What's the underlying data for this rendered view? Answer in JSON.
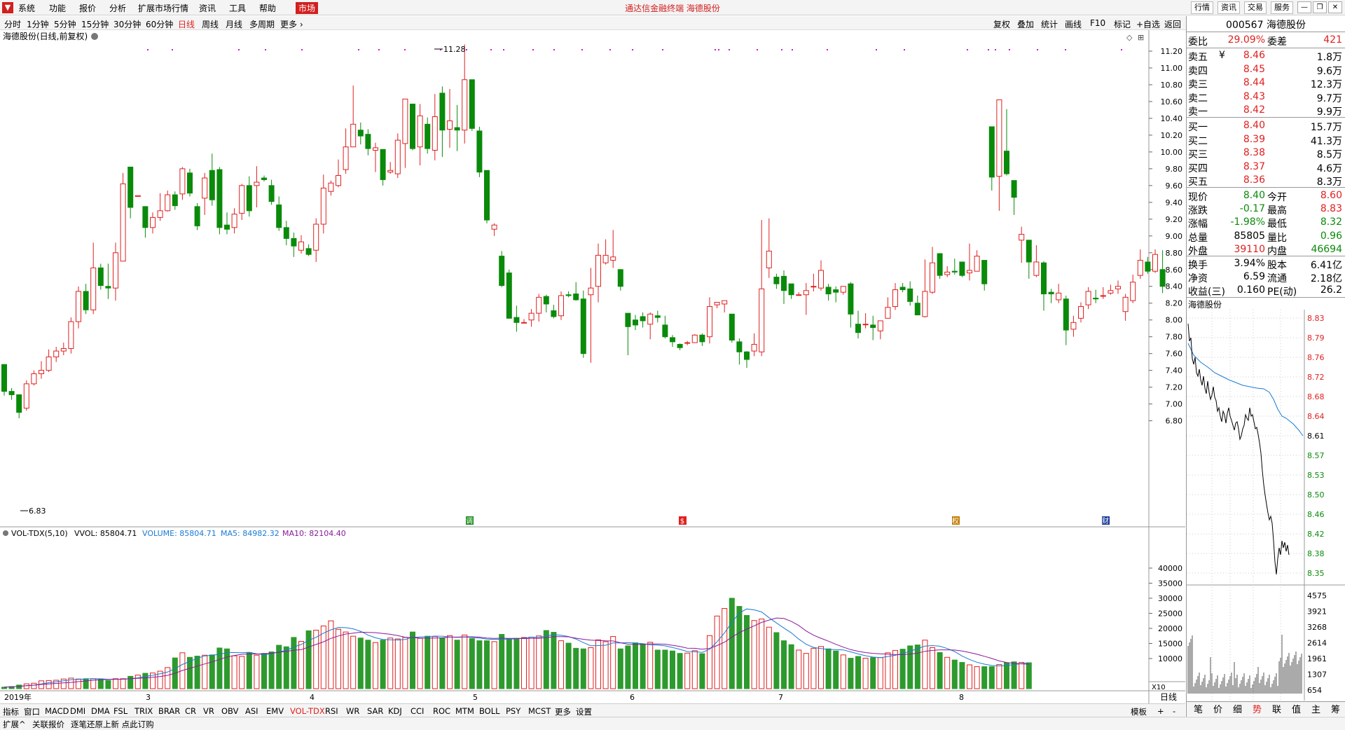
{
  "menubar": {
    "items": [
      "系统",
      "功能",
      "报价",
      "分析",
      "扩展市场行情",
      "资讯",
      "工具",
      "帮助"
    ],
    "active": "市场",
    "title": "通达信金融终端  海德股份",
    "right_buttons": [
      "行情",
      "资讯",
      "交易",
      "服务"
    ]
  },
  "periods": {
    "items": [
      "分时",
      "1分钟",
      "5分钟",
      "15分钟",
      "30分钟",
      "60分钟",
      "日线",
      "周线",
      "月线",
      "多周期",
      "更多"
    ],
    "active": "日线",
    "right": [
      "复权",
      "叠加",
      "统计",
      "画线",
      "F10",
      "标记",
      "+自选",
      "返回"
    ]
  },
  "main_chart": {
    "label": "海德股份(日线,前复权)",
    "high_mark": "11.28",
    "low_mark": "6.83",
    "markers": [
      "调",
      "$",
      "权",
      "财"
    ]
  },
  "vol_header": {
    "name": "VOL-TDX(5,10)",
    "vvol": "VVOL: 85804.71",
    "volume": "VOLUME: 85804.71",
    "ma5": "MA5: 84982.32",
    "ma10": "MA10: 82104.40"
  },
  "x_axis": {
    "year": "2019年",
    "months": [
      "3",
      "4",
      "5",
      "6",
      "7",
      "8"
    ],
    "unit": "X10",
    "period": "日线"
  },
  "indicator_tabs": [
    "指标",
    "窗口",
    "MACD",
    "DMI",
    "DMA",
    "FSL",
    "TRIX",
    "BRAR",
    "CR",
    "VR",
    "OBV",
    "ASI",
    "EMV",
    "VOL-TDX",
    "RSI",
    "WR",
    "SAR",
    "KDJ",
    "CCI",
    "ROC",
    "MTM",
    "BOLL",
    "PSY",
    "MCST",
    "更多",
    "设置"
  ],
  "indicator_active": "VOL-TDX",
  "template_label": "模板",
  "status": {
    "items": [
      "扩展^",
      "关联报价",
      "逐笔还原上新 点此订购"
    ]
  },
  "quote": {
    "code": "000567",
    "name": "海德股份",
    "weibi_label": "委比",
    "weibi": "29.09%",
    "weicha_label": "委差",
    "weicha": "421",
    "asks": [
      {
        "label": "卖五",
        "price": "8.46",
        "vol": "1.8万"
      },
      {
        "label": "卖四",
        "price": "8.45",
        "vol": "9.6万"
      },
      {
        "label": "卖三",
        "price": "8.44",
        "vol": "12.3万"
      },
      {
        "label": "卖二",
        "price": "8.43",
        "vol": "9.7万"
      },
      {
        "label": "卖一",
        "price": "8.42",
        "vol": "9.9万"
      }
    ],
    "bids": [
      {
        "label": "买一",
        "price": "8.40",
        "vol": "15.7万"
      },
      {
        "label": "买二",
        "price": "8.39",
        "vol": "41.3万"
      },
      {
        "label": "买三",
        "price": "8.38",
        "vol": "8.5万"
      },
      {
        "label": "买四",
        "price": "8.37",
        "vol": "4.6万"
      },
      {
        "label": "买五",
        "price": "8.36",
        "vol": "8.3万"
      }
    ],
    "yen": "¥",
    "stats": [
      {
        "l1": "现价",
        "v1": "8.40",
        "c1": "grn",
        "l2": "今开",
        "v2": "8.60",
        "c2": "red"
      },
      {
        "l1": "涨跌",
        "v1": "-0.17",
        "c1": "grn",
        "l2": "最高",
        "v2": "8.83",
        "c2": "red"
      },
      {
        "l1": "涨幅",
        "v1": "-1.98%",
        "c1": "grn",
        "l2": "最低",
        "v2": "8.32",
        "c2": "grn"
      },
      {
        "l1": "总量",
        "v1": "85805",
        "c1": "",
        "l2": "量比",
        "v2": "0.96",
        "c2": "grn"
      },
      {
        "l1": "外盘",
        "v1": "39110",
        "c1": "red",
        "l2": "内盘",
        "v2": "46694",
        "c2": "grn"
      }
    ],
    "stats2": [
      {
        "l1": "换手",
        "v1": "3.94%",
        "l2": "股本",
        "v2": "6.41亿"
      },
      {
        "l1": "净资",
        "v1": "6.59",
        "l2": "流通",
        "v2": "2.18亿"
      },
      {
        "l1": "收益(三)",
        "v1": "0.160",
        "l2": "PE(动)",
        "v2": "26.2"
      }
    ],
    "mini_title": "海德股份",
    "mini_price_axis": [
      "8.83",
      "8.79",
      "8.76",
      "8.72",
      "8.68",
      "8.64",
      "8.61",
      "8.57",
      "8.53",
      "8.50",
      "8.46",
      "8.42",
      "8.38",
      "8.35"
    ],
    "mini_vol_axis": [
      "4575",
      "3921",
      "3268",
      "2614",
      "1961",
      "1307",
      "654"
    ],
    "bottom_tabs": [
      "笔",
      "价",
      "细",
      "势",
      "联",
      "值",
      "主",
      "筹"
    ],
    "bottom_active": "势"
  },
  "colors": {
    "up": "#e02020",
    "down": "#0a8a0a",
    "vol_down": "#2d9a2d",
    "ma5": "#1a7ad4",
    "ma10": "#8a1a9a"
  },
  "chart_data": {
    "type": "candlestick",
    "price_axis": [
      "11.20",
      "11.00",
      "10.80",
      "10.60",
      "10.40",
      "10.20",
      "10.00",
      "9.80",
      "9.60",
      "9.40",
      "9.20",
      "9.00",
      "8.80",
      "8.60",
      "8.40",
      "8.20",
      "8.00",
      "7.80",
      "7.60",
      "7.40",
      "7.20",
      "7.00",
      "6.80"
    ],
    "ylim": [
      6.68,
      11.35
    ],
    "vol_axis": [
      "40000",
      "35000",
      "30000",
      "25000",
      "20000",
      "15000",
      "10000"
    ],
    "vol_ylim": [
      0,
      43000
    ],
    "candles": [
      [
        7.47,
        7.15,
        7.47,
        7.1
      ],
      [
        7.15,
        7.11,
        7.19,
        7.05
      ],
      [
        7.11,
        6.9,
        7.11,
        6.83
      ],
      [
        6.95,
        7.24,
        7.28,
        6.92
      ],
      [
        7.24,
        7.36,
        7.4,
        7.22
      ],
      [
        7.36,
        7.4,
        7.51,
        7.3
      ],
      [
        7.4,
        7.56,
        7.65,
        7.38
      ],
      [
        7.56,
        7.63,
        7.68,
        7.5
      ],
      [
        7.63,
        7.66,
        7.73,
        7.58
      ],
      [
        7.66,
        7.98,
        8.03,
        7.6
      ],
      [
        7.98,
        8.34,
        8.4,
        7.9
      ],
      [
        8.34,
        8.12,
        8.43,
        8.07
      ],
      [
        8.12,
        8.62,
        8.92,
        8.07
      ],
      [
        8.62,
        8.41,
        8.67,
        8.36
      ],
      [
        8.4,
        8.38,
        8.67,
        8.25
      ],
      [
        8.38,
        8.8,
        8.92,
        8.23
      ],
      [
        8.7,
        9.62,
        9.75,
        9.0
      ],
      [
        9.82,
        9.34,
        9.82,
        9.21
      ],
      [
        9.47,
        9.48,
        9.48,
        9.47
      ],
      [
        9.35,
        9.1,
        9.35,
        8.98
      ],
      [
        9.1,
        9.22,
        9.28,
        9.03
      ],
      [
        9.22,
        9.3,
        9.51,
        9.18
      ],
      [
        9.3,
        9.49,
        9.54,
        9.29
      ],
      [
        9.49,
        9.36,
        9.53,
        9.31
      ],
      [
        9.5,
        9.8,
        9.82,
        9.43
      ],
      [
        9.75,
        9.51,
        9.8,
        9.47
      ],
      [
        9.35,
        9.12,
        9.39,
        9.07
      ],
      [
        9.45,
        9.69,
        9.75,
        9.25
      ],
      [
        9.78,
        9.43,
        9.98,
        9.36
      ],
      [
        9.79,
        9.1,
        9.82,
        9.02
      ],
      [
        9.13,
        9.08,
        9.28,
        9.02
      ],
      [
        9.1,
        9.26,
        9.33,
        9.03
      ],
      [
        9.27,
        9.6,
        9.62,
        9.19
      ],
      [
        9.6,
        9.3,
        9.71,
        9.23
      ],
      [
        9.6,
        9.64,
        9.83,
        9.34
      ],
      [
        9.69,
        9.67,
        9.72,
        9.65
      ],
      [
        9.6,
        9.41,
        9.67,
        9.37
      ],
      [
        9.37,
        9.1,
        9.47,
        9.06
      ],
      [
        9.1,
        8.97,
        9.18,
        8.89
      ],
      [
        8.97,
        8.88,
        9.04,
        8.75
      ],
      [
        8.83,
        8.93,
        9.01,
        8.79
      ],
      [
        8.85,
        8.78,
        8.9,
        8.76
      ],
      [
        8.83,
        9.14,
        9.21,
        8.69
      ],
      [
        9.14,
        9.57,
        9.73,
        9.03
      ],
      [
        9.53,
        9.63,
        9.66,
        9.48
      ],
      [
        9.6,
        9.72,
        9.91,
        9.58
      ],
      [
        9.79,
        10.06,
        10.28,
        9.74
      ],
      [
        10.06,
        10.33,
        10.79,
        10.07
      ],
      [
        10.26,
        10.19,
        10.35,
        10.09
      ],
      [
        10.21,
        10.04,
        10.27,
        9.96
      ],
      [
        10.02,
        10.05,
        10.11,
        9.76
      ],
      [
        10.03,
        9.67,
        10.03,
        9.6
      ],
      [
        9.76,
        9.78,
        9.88,
        9.74
      ],
      [
        9.74,
        10.14,
        10.22,
        9.69
      ],
      [
        10.1,
        10.63,
        10.63,
        9.81
      ],
      [
        10.57,
        10.04,
        10.57,
        10.02
      ],
      [
        10.06,
        10.43,
        10.57,
        9.84
      ],
      [
        10.33,
        10.04,
        10.41,
        9.98
      ],
      [
        10.02,
        10.42,
        10.69,
        9.9
      ],
      [
        10.7,
        10.26,
        10.78,
        9.94
      ],
      [
        10.27,
        10.37,
        10.75,
        10.05
      ],
      [
        10.29,
        10.26,
        10.56,
        10.01
      ],
      [
        10.26,
        10.86,
        11.28,
        10.1
      ],
      [
        10.86,
        10.28,
        10.86,
        10.25
      ],
      [
        10.25,
        9.76,
        10.3,
        9.7
      ],
      [
        9.78,
        9.19,
        9.78,
        9.15
      ],
      [
        9.08,
        9.13,
        9.15,
        9.0
      ],
      [
        8.76,
        8.41,
        8.82,
        8.39
      ],
      [
        8.56,
        8.02,
        8.6,
        8.02
      ],
      [
        8.03,
        7.97,
        8.17,
        7.86
      ],
      [
        7.97,
        7.97,
        8.01,
        7.96
      ],
      [
        8.0,
        8.08,
        8.13,
        7.92
      ],
      [
        8.08,
        8.27,
        8.31,
        7.98
      ],
      [
        8.28,
        8.19,
        8.3,
        8.09
      ],
      [
        8.11,
        8.04,
        8.18,
        8.02
      ],
      [
        8.05,
        8.29,
        8.34,
        8.0
      ],
      [
        8.3,
        8.29,
        8.34,
        8.27
      ],
      [
        8.31,
        8.24,
        8.45,
        8.23
      ],
      [
        8.25,
        7.6,
        8.35,
        7.55
      ],
      [
        8.3,
        8.38,
        8.62,
        7.49
      ],
      [
        8.4,
        8.77,
        8.91,
        8.21
      ],
      [
        8.68,
        8.77,
        8.96,
        8.66
      ],
      [
        8.71,
        8.75,
        9.07,
        8.62
      ],
      [
        8.6,
        8.4,
        8.6,
        8.35
      ],
      [
        8.08,
        7.92,
        8.08,
        7.58
      ],
      [
        8.0,
        7.94,
        8.06,
        7.88
      ],
      [
        8.04,
        7.99,
        8.09,
        7.91
      ],
      [
        7.95,
        8.07,
        8.09,
        7.77
      ],
      [
        8.05,
        8.03,
        8.11,
        7.97
      ],
      [
        7.94,
        7.8,
        8.05,
        7.78
      ],
      [
        7.79,
        7.74,
        7.82,
        7.68
      ],
      [
        7.71,
        7.67,
        7.72,
        7.64
      ],
      [
        7.73,
        7.73,
        7.75,
        7.7
      ],
      [
        7.73,
        7.82,
        7.83,
        7.74
      ],
      [
        7.82,
        7.74,
        7.84,
        7.69
      ],
      [
        7.8,
        8.16,
        8.27,
        7.72
      ],
      [
        8.18,
        8.21,
        8.2,
        8.14
      ],
      [
        8.19,
        8.23,
        8.23,
        8.09
      ],
      [
        8.07,
        7.76,
        8.07,
        7.73
      ],
      [
        7.74,
        7.62,
        7.78,
        7.47
      ],
      [
        7.62,
        7.53,
        7.63,
        7.43
      ],
      [
        7.63,
        7.71,
        7.84,
        7.57
      ],
      [
        7.62,
        8.37,
        9.19,
        7.57
      ],
      [
        8.62,
        8.82,
        9.21,
        8.5
      ],
      [
        8.51,
        8.43,
        8.55,
        8.37
      ],
      [
        8.52,
        8.35,
        8.59,
        8.19
      ],
      [
        8.43,
        8.3,
        8.42,
        8.25
      ],
      [
        8.3,
        8.3,
        8.33,
        8.29
      ],
      [
        8.3,
        8.35,
        8.44,
        8.06
      ],
      [
        8.4,
        8.4,
        8.55,
        8.34
      ],
      [
        8.38,
        8.59,
        8.71,
        8.35
      ],
      [
        8.39,
        8.31,
        8.43,
        8.23
      ],
      [
        8.36,
        8.33,
        8.4,
        8.21
      ],
      [
        8.33,
        8.4,
        8.4,
        8.3
      ],
      [
        8.43,
        8.07,
        8.45,
        7.91
      ],
      [
        7.95,
        7.85,
        8.11,
        7.78
      ],
      [
        7.95,
        7.95,
        8.08,
        7.9
      ],
      [
        7.94,
        7.91,
        8.05,
        7.76
      ],
      [
        7.87,
        7.99,
        7.98,
        7.77
      ],
      [
        8.02,
        8.15,
        8.27,
        8.11
      ],
      [
        8.16,
        8.36,
        8.44,
        8.12
      ],
      [
        8.39,
        8.36,
        8.44,
        8.33
      ],
      [
        8.37,
        8.22,
        8.46,
        8.17
      ],
      [
        8.2,
        8.06,
        8.29,
        8.1
      ],
      [
        8.04,
        8.34,
        8.72,
        8.03
      ],
      [
        8.33,
        8.68,
        8.87,
        8.31
      ],
      [
        8.79,
        8.53,
        8.79,
        8.49
      ],
      [
        8.54,
        8.57,
        8.64,
        8.51
      ],
      [
        8.58,
        8.57,
        8.73,
        8.54
      ],
      [
        8.69,
        8.53,
        8.69,
        8.51
      ],
      [
        8.56,
        8.59,
        8.91,
        8.47
      ],
      [
        8.58,
        8.76,
        8.83,
        8.69
      ],
      [
        8.71,
        8.43,
        8.71,
        8.35
      ],
      [
        10.3,
        9.7,
        10.3,
        9.54
      ],
      [
        9.71,
        10.62,
        10.62,
        9.3
      ],
      [
        10.01,
        9.74,
        10.51,
        9.72
      ],
      [
        9.66,
        9.46,
        9.66,
        9.25
      ],
      [
        8.95,
        9.02,
        9.11,
        8.68
      ],
      [
        8.95,
        8.69,
        8.95,
        8.49
      ],
      [
        8.53,
        8.69,
        8.89,
        8.51
      ],
      [
        8.68,
        8.31,
        8.7,
        8.11
      ],
      [
        8.33,
        8.31,
        8.37,
        8.2
      ],
      [
        8.24,
        8.32,
        8.43,
        8.2
      ],
      [
        8.25,
        7.88,
        8.29,
        7.7
      ],
      [
        7.89,
        7.97,
        8.05,
        7.8
      ],
      [
        8.02,
        8.16,
        8.21,
        7.97
      ],
      [
        8.18,
        8.34,
        8.39,
        8.13
      ],
      [
        8.26,
        8.25,
        8.36,
        8.2
      ],
      [
        8.29,
        8.29,
        8.39,
        8.25
      ],
      [
        8.32,
        8.35,
        8.42,
        8.3
      ],
      [
        8.37,
        8.4,
        8.47,
        8.31
      ],
      [
        8.1,
        8.27,
        8.31,
        7.99
      ],
      [
        8.23,
        8.45,
        8.54,
        8.2
      ],
      [
        8.53,
        8.71,
        8.84,
        8.49
      ],
      [
        8.69,
        8.58,
        8.75,
        8.55
      ],
      [
        8.58,
        8.78,
        8.84,
        8.56
      ],
      [
        8.6,
        8.4,
        8.83,
        8.32
      ]
    ],
    "volumes": [
      500,
      700,
      700,
      900,
      1200,
      1300,
      1600,
      1500,
      1800,
      2400,
      2600,
      2800,
      2700,
      2600,
      2800,
      3500,
      3200,
      3600,
      3500,
      3300,
      3200,
      3400,
      3300,
      3300,
      3300,
      3200,
      3100,
      3300,
      2700,
      3200,
      3300,
      3300,
      3300,
      3600,
      4100,
      4000,
      4500,
      4900,
      5100,
      5200,
      5200,
      5300,
      5800,
      6600,
      7000,
      7300,
      10200,
      10000,
      11900,
      10800,
      10400,
      10800,
      10800,
      10900,
      11100,
      11800,
      11200,
      12400,
      13500,
      13800,
      13200,
      11700,
      10900,
      11300,
      10700,
      11200,
      12000,
      11200,
      11100,
      11700,
      11700,
      10600,
      12200,
      11400,
      14400,
      14400,
      13900,
      15900,
      17000,
      17300,
      15700,
      18300,
      19200,
      18800,
      19400,
      18900,
      20800,
      21700,
      22500,
      22000,
      19700,
      19300,
      18800,
      18200,
      17400,
      16600,
      16800,
      16400,
      16100,
      15700,
      15300,
      16500,
      16100,
      16300,
      16800,
      16900,
      16500,
      16500,
      17000,
      17800,
      18800,
      18200,
      16700,
      16300,
      17400,
      17900,
      17300,
      17300,
      16800,
      16600,
      17600,
      17100,
      16100,
      17000,
      17800,
      17200,
      16600,
      16400,
      15900,
      15700,
      15900,
      15600,
      15600,
      18400,
      18000,
      17700,
      16600,
      17000,
      16700,
      17200,
      17000,
      16600,
      17100,
      18000,
      17500,
      17900,
      19300,
      21600,
      18700,
      16700,
      15900,
      15800,
      15100,
      14400,
      13400,
      13500,
      13200,
      12600,
      13600,
      13500,
      16200,
      16100,
      15600,
      18500,
      17300,
      15700,
      13200,
      13600,
      14200,
      15000,
      15200,
      15700,
      14800,
      16000,
      15400,
      14700,
      12800,
      11400,
      12800,
      12100,
      12500,
      12300,
      11700,
      11400,
      11800,
      11900,
      12600,
      11700,
      11600,
      15400,
      17600,
      22000,
      24100,
      27200,
      26600,
      30000,
      30000,
      30000,
      27300,
      25300,
      24300,
      22600,
      22600,
      23400,
      23100,
      21500,
      20400,
      19800,
      18600,
      17100,
      15900,
      15700,
      14600,
      13700,
      12800,
      12100,
      11700,
      13500,
      13400,
      14800,
      14000,
      14400,
      13200,
      14000,
      12500,
      11600,
      11200,
      10800,
      10100,
      10900,
      10700,
      11400,
      10100,
      11900,
      10300,
      11900,
      10300,
      11200,
      11900,
      12800,
      12700,
      12800,
      13100,
      14000,
      14200,
      14800,
      14500,
      16400,
      16100,
      15500,
      13600,
      12800,
      12000,
      11100,
      10400,
      9500,
      9500,
      9100,
      8700,
      8300,
      7900,
      7600,
      7300,
      7300,
      7300,
      7300,
      7300,
      7400,
      8000,
      8500,
      8600,
      9100,
      8900,
      8600,
      8700,
      8600,
      8600
    ]
  }
}
